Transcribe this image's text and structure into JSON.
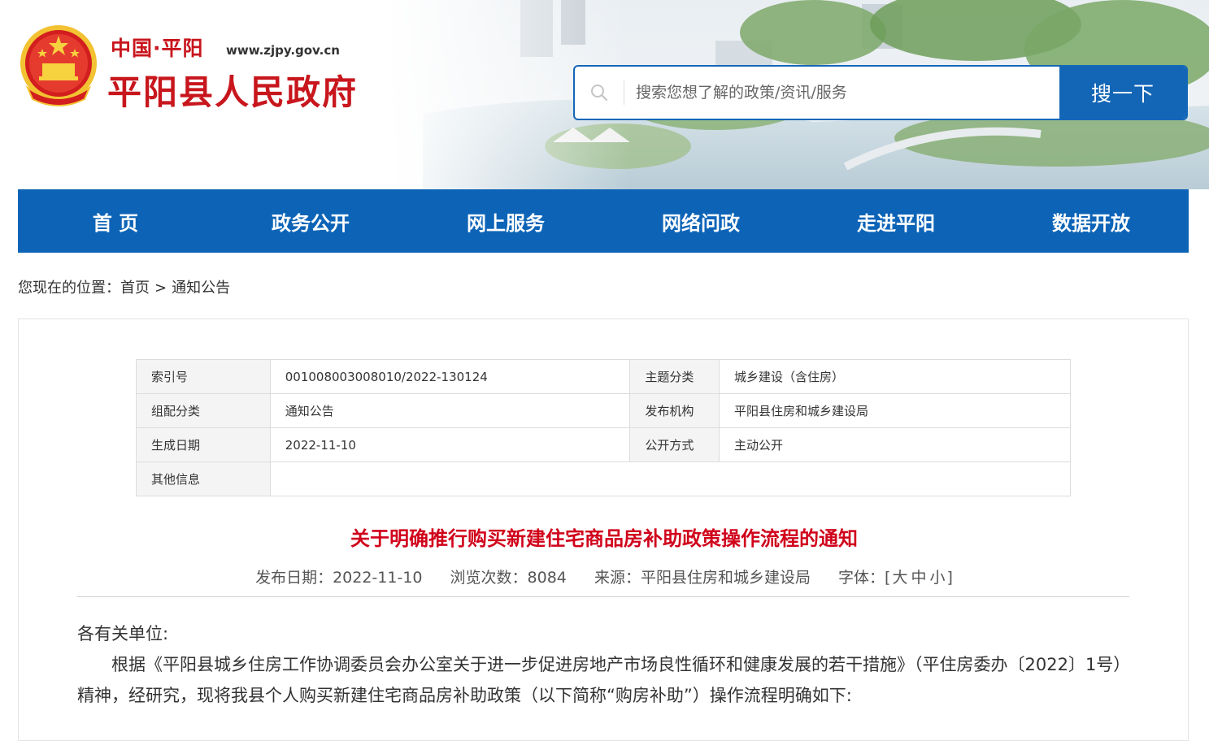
{
  "header": {
    "site_name_small": "中国·平阳",
    "site_url": "www.zjpy.gov.cn",
    "site_title": "平阳县人民政府"
  },
  "search": {
    "placeholder": "搜索您想了解的政策/资讯/服务",
    "button_label": "搜一下"
  },
  "nav": {
    "items": [
      "首 页",
      "政务公开",
      "网上服务",
      "网络问政",
      "走进平阳",
      "数据开放"
    ]
  },
  "breadcrumb": {
    "prefix": "您现在的位置：",
    "home": "首页",
    "sep": ">",
    "current": "通知公告"
  },
  "meta": {
    "index_label": "索引号",
    "index_value": "001008003008010/2022-130124",
    "topic_label": "主题分类",
    "topic_value": "城乡建设（含住房）",
    "category_label": "组配分类",
    "category_value": "通知公告",
    "publisher_label": "发布机构",
    "publisher_value": "平阳县住房和城乡建设局",
    "date_label": "生成日期",
    "date_value": "2022-11-10",
    "disclosure_label": "公开方式",
    "disclosure_value": "主动公开",
    "other_label": "其他信息",
    "other_value": ""
  },
  "article": {
    "title": "关于明确推行购买新建住宅商品房补助政策操作流程的通知",
    "publish_date": "发布日期：2022-11-10",
    "views": "浏览次数：8084",
    "source": "来源：平阳县住房和城乡建设局",
    "font_label": "字体：[",
    "font_large": "大",
    "font_medium": "中",
    "font_small": "小",
    "font_close": "]",
    "salutation": "各有关单位:",
    "paragraph1": "根据《平阳县城乡住房工作协调委员会办公室关于进一步促进房地产市场良性循环和健康发展的若干措施》（平住房委办〔2022〕1号）精神，经研究，现将我县个人购买新建住宅商品房补助政策（以下简称“购房补助”）操作流程明确如下:"
  },
  "colors": {
    "brand_red": "#c8161d",
    "nav_blue": "#0d64b7",
    "title_red": "#d0021b"
  }
}
